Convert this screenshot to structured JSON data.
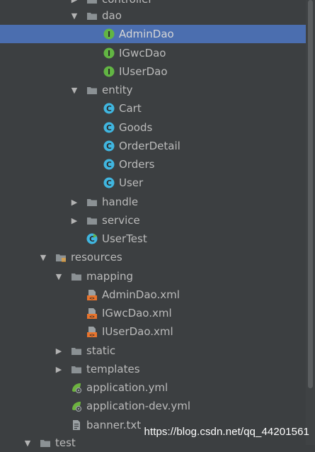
{
  "tree": {
    "items": [
      {
        "label": "controller",
        "icon": "folder-icon",
        "arrow": "right",
        "selected": false
      },
      {
        "label": "dao",
        "icon": "folder-icon",
        "arrow": "down",
        "selected": false
      },
      {
        "label": "AdminDao",
        "icon": "interface-icon",
        "arrow": "none",
        "selected": true
      },
      {
        "label": "IGwcDao",
        "icon": "interface-icon",
        "arrow": "none",
        "selected": false
      },
      {
        "label": "IUserDao",
        "icon": "interface-icon",
        "arrow": "none",
        "selected": false
      },
      {
        "label": "entity",
        "icon": "folder-icon",
        "arrow": "down",
        "selected": false
      },
      {
        "label": "Cart",
        "icon": "class-icon",
        "arrow": "none",
        "selected": false
      },
      {
        "label": "Goods",
        "icon": "class-icon",
        "arrow": "none",
        "selected": false
      },
      {
        "label": "OrderDetail",
        "icon": "class-icon",
        "arrow": "none",
        "selected": false
      },
      {
        "label": "Orders",
        "icon": "class-icon",
        "arrow": "none",
        "selected": false
      },
      {
        "label": "User",
        "icon": "class-icon",
        "arrow": "none",
        "selected": false
      },
      {
        "label": "handle",
        "icon": "folder-icon",
        "arrow": "right",
        "selected": false
      },
      {
        "label": "service",
        "icon": "folder-icon",
        "arrow": "right",
        "selected": false
      },
      {
        "label": "UserTest",
        "icon": "test-class-icon",
        "arrow": "none",
        "selected": false
      },
      {
        "label": "resources",
        "icon": "resources-folder-icon",
        "arrow": "down",
        "selected": false
      },
      {
        "label": "mapping",
        "icon": "folder-icon",
        "arrow": "down",
        "selected": false
      },
      {
        "label": "AdminDao.xml",
        "icon": "xml-file-icon",
        "arrow": "none",
        "selected": false
      },
      {
        "label": "IGwcDao.xml",
        "icon": "xml-file-icon",
        "arrow": "none",
        "selected": false
      },
      {
        "label": "IUserDao.xml",
        "icon": "xml-file-icon",
        "arrow": "none",
        "selected": false
      },
      {
        "label": "static",
        "icon": "folder-icon",
        "arrow": "right",
        "selected": false
      },
      {
        "label": "templates",
        "icon": "folder-icon",
        "arrow": "right",
        "selected": false
      },
      {
        "label": "application.yml",
        "icon": "spring-config-icon",
        "arrow": "none",
        "selected": false
      },
      {
        "label": "application-dev.yml",
        "icon": "spring-config-icon",
        "arrow": "none",
        "selected": false
      },
      {
        "label": "banner.txt",
        "icon": "text-file-icon",
        "arrow": "none",
        "selected": false
      },
      {
        "label": "test",
        "icon": "folder-icon",
        "arrow": "down",
        "selected": false
      }
    ]
  },
  "watermark": "https://blog.csdn.net/qq_44201561",
  "colors": {
    "background": "#3c3f41",
    "selection": "#4b6eaf",
    "interface": "#62b543",
    "class": "#40b6e0",
    "xml": "#e8742d"
  }
}
